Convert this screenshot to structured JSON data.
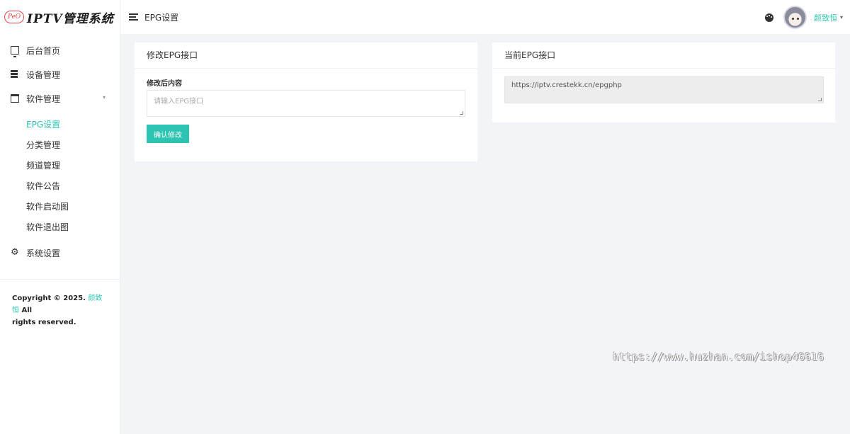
{
  "brand": {
    "logo": "PeO",
    "name": "IPTV管理系统"
  },
  "header": {
    "title": "EPG设置",
    "username": "颜致恒"
  },
  "sidebar": {
    "items": [
      {
        "label": "后台首页",
        "icon": "monitor-icon"
      },
      {
        "label": "设备管理",
        "icon": "database-icon"
      },
      {
        "label": "软件管理",
        "icon": "window-icon"
      },
      {
        "label": "系统设置",
        "icon": "gear-icon"
      }
    ],
    "sub_items": [
      {
        "label": "EPG设置",
        "active": true
      },
      {
        "label": "分类管理"
      },
      {
        "label": "频道管理"
      },
      {
        "label": "软件公告"
      },
      {
        "label": "软件启动图"
      },
      {
        "label": "软件退出图"
      }
    ],
    "copyright_prefix": "Copyright © 2025.",
    "copyright_author": "颜致恒",
    "copyright_all": "All",
    "copyright_suffix": "rights reserved."
  },
  "edit_card": {
    "title": "修改EPG接口",
    "field_label": "修改后内容",
    "placeholder": "请输入EPG接口",
    "button": "确认修改"
  },
  "current_card": {
    "title": "当前EPG接口",
    "value": "https://iptv.crestekk.cn/epgphp"
  },
  "watermark": "https://www.huzhan.com/ishop46616",
  "colors": {
    "accent": "#2dc4b2",
    "background": "#f3f4f8"
  }
}
